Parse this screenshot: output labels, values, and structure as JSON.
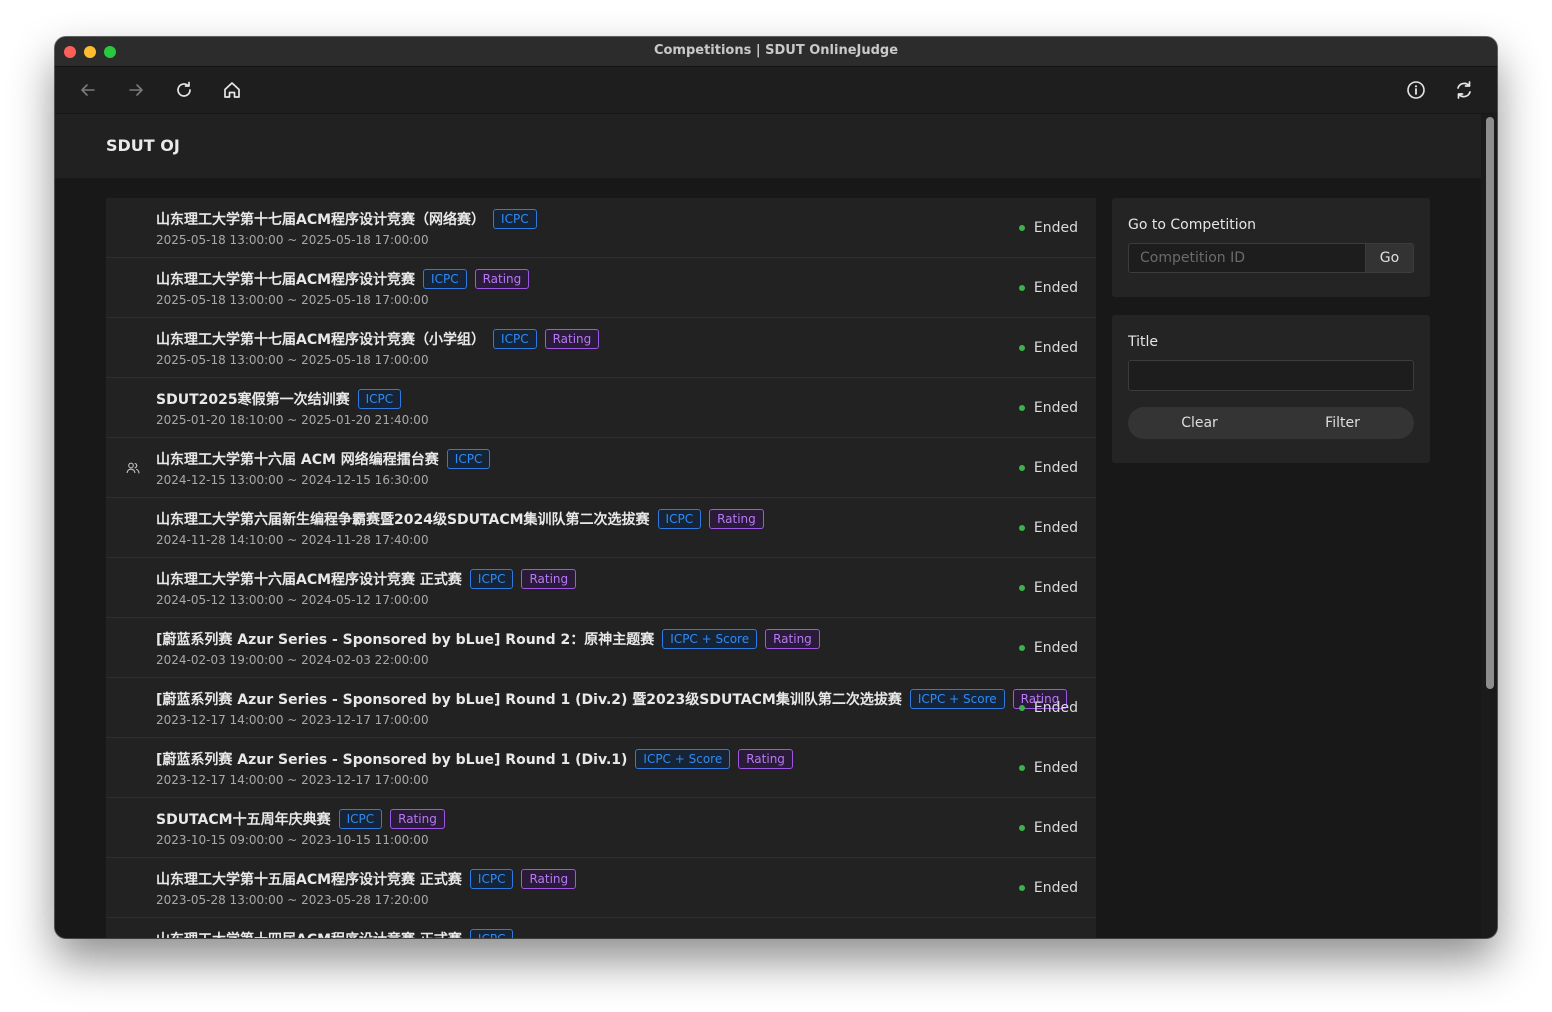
{
  "window": {
    "title": "Competitions | SDUT OnlineJudge"
  },
  "toolbar": {
    "back_icon": "arrow-left-icon",
    "forward_icon": "arrow-right-icon",
    "reload_icon": "reload-icon",
    "home_icon": "home-icon",
    "info_icon": "info-icon",
    "sync_icon": "sync-icon"
  },
  "site": {
    "title": "SDUT OJ"
  },
  "competitions": [
    {
      "title": "山东理工大学第十七届ACM程序设计竞赛（网络赛）",
      "tags": [
        "ICPC"
      ],
      "time": "2025-05-18 13:00:00 ~ 2025-05-18 17:00:00",
      "status": "Ended",
      "icon": false
    },
    {
      "title": "山东理工大学第十七届ACM程序设计竞赛",
      "tags": [
        "ICPC",
        "Rating"
      ],
      "time": "2025-05-18 13:00:00 ~ 2025-05-18 17:00:00",
      "status": "Ended",
      "icon": false
    },
    {
      "title": "山东理工大学第十七届ACM程序设计竞赛（小学组）",
      "tags": [
        "ICPC",
        "Rating"
      ],
      "time": "2025-05-18 13:00:00 ~ 2025-05-18 17:00:00",
      "status": "Ended",
      "icon": false
    },
    {
      "title": "SDUT2025寒假第一次结训赛",
      "tags": [
        "ICPC"
      ],
      "time": "2025-01-20 18:10:00 ~ 2025-01-20 21:40:00",
      "status": "Ended",
      "icon": false
    },
    {
      "title": "山东理工大学第十六届 ACM 网络编程擂台赛",
      "tags": [
        "ICPC"
      ],
      "time": "2024-12-15 13:00:00 ~ 2024-12-15 16:30:00",
      "status": "Ended",
      "icon": true
    },
    {
      "title": "山东理工大学第六届新生编程争霸赛暨2024级SDUTACM集训队第二次选拔赛",
      "tags": [
        "ICPC",
        "Rating"
      ],
      "time": "2024-11-28 14:10:00 ~ 2024-11-28 17:40:00",
      "status": "Ended",
      "icon": false
    },
    {
      "title": "山东理工大学第十六届ACM程序设计竞赛 正式赛",
      "tags": [
        "ICPC",
        "Rating"
      ],
      "time": "2024-05-12 13:00:00 ~ 2024-05-12 17:00:00",
      "status": "Ended",
      "icon": false
    },
    {
      "title": "[蔚蓝系列赛 Azur Series - Sponsored by bLue] Round 2：原神主题赛",
      "tags": [
        "ICPC + Score",
        "Rating"
      ],
      "time": "2024-02-03 19:00:00 ~ 2024-02-03 22:00:00",
      "status": "Ended",
      "icon": false
    },
    {
      "title": "[蔚蓝系列赛 Azur Series - Sponsored by bLue] Round 1 (Div.2) 暨2023级SDUTACM集训队第二次选拔赛",
      "tags": [
        "ICPC + Score",
        "Rating"
      ],
      "time": "2023-12-17 14:00:00 ~ 2023-12-17 17:00:00",
      "status": "Ended",
      "icon": false
    },
    {
      "title": "[蔚蓝系列赛 Azur Series - Sponsored by bLue] Round 1 (Div.1)",
      "tags": [
        "ICPC + Score",
        "Rating"
      ],
      "time": "2023-12-17 14:00:00 ~ 2023-12-17 17:00:00",
      "status": "Ended",
      "icon": false
    },
    {
      "title": "SDUTACM十五周年庆典赛",
      "tags": [
        "ICPC",
        "Rating"
      ],
      "time": "2023-10-15 09:00:00 ~ 2023-10-15 11:00:00",
      "status": "Ended",
      "icon": false
    },
    {
      "title": "山东理工大学第十五届ACM程序设计竞赛 正式赛",
      "tags": [
        "ICPC",
        "Rating"
      ],
      "time": "2023-05-28 13:00:00 ~ 2023-05-28 17:20:00",
      "status": "Ended",
      "icon": false
    },
    {
      "title": "山东理工大学第十四届ACM程序设计竞赛 正式赛",
      "tags": [
        "ICPC"
      ],
      "time": "",
      "status": "",
      "icon": false
    }
  ],
  "goto_panel": {
    "label": "Go to Competition",
    "placeholder": "Competition ID",
    "go_label": "Go"
  },
  "filter_panel": {
    "label": "Title",
    "title_value": "",
    "clear_label": "Clear",
    "filter_label": "Filter"
  },
  "colors": {
    "icpc_tag": "#2f8bf5",
    "rating_tag": "#b67af2",
    "status_dot": "#3cb34a"
  }
}
